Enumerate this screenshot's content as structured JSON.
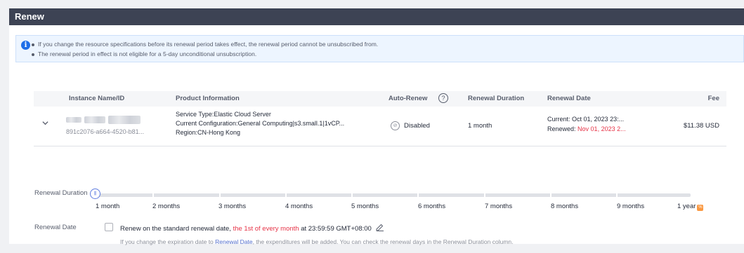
{
  "dialog": {
    "title": "Renew"
  },
  "notice": {
    "lines": [
      "If you change the resource specifications before its renewal period takes effect, the renewal period cannot be unsubscribed from.",
      "The renewal period in effect is not eligible for a 5-day unconditional unsubscription."
    ]
  },
  "table": {
    "headers": {
      "instance": "Instance Name/ID",
      "product": "Product Information",
      "auto_renew": "Auto-Renew",
      "duration": "Renewal Duration",
      "date": "Renewal Date",
      "fee": "Fee"
    },
    "row": {
      "instance_id": "891c2076-a664-4520-b81...",
      "service_type": "Service Type:Elastic Cloud Server",
      "configuration": "Current Configuration:General Computing|s3.small.1|1vCP...",
      "region": "Region:CN-Hong Kong",
      "auto_renew": "Disabled",
      "duration": "1 month",
      "current_label": "Current:",
      "current_date": "Oct 01, 2023 23:...",
      "renewed_label": "Renewed:",
      "renewed_date": "Nov 01, 2023 2...",
      "fee": "$11.38 USD"
    }
  },
  "renewal_duration": {
    "label": "Renewal Duration",
    "handle_icon": "drag-handle-icon",
    "selected_index": 0,
    "options": [
      "1 month",
      "2 months",
      "3 months",
      "4 months",
      "5 months",
      "6 months",
      "7 months",
      "8 months",
      "9 months",
      "1 year"
    ]
  },
  "renewal_date": {
    "label": "Renewal Date",
    "checked": false,
    "text_before": "Renew on the standard renewal date,",
    "text_highlight": "the 1st of every month",
    "text_after": "at 23:59:59 GMT+08:00",
    "hint_before": "If you change the expiration date to",
    "hint_link": "Renewal Date",
    "hint_after": ", the expenditures will be added. You can check the renewal days in the Renewal Duration column."
  },
  "colors": {
    "header_bar": "#3d4354",
    "accent": "#5e7ce0",
    "warning_red": "#e63246",
    "link": "#526ecc",
    "year_badge": "#fa9841"
  }
}
